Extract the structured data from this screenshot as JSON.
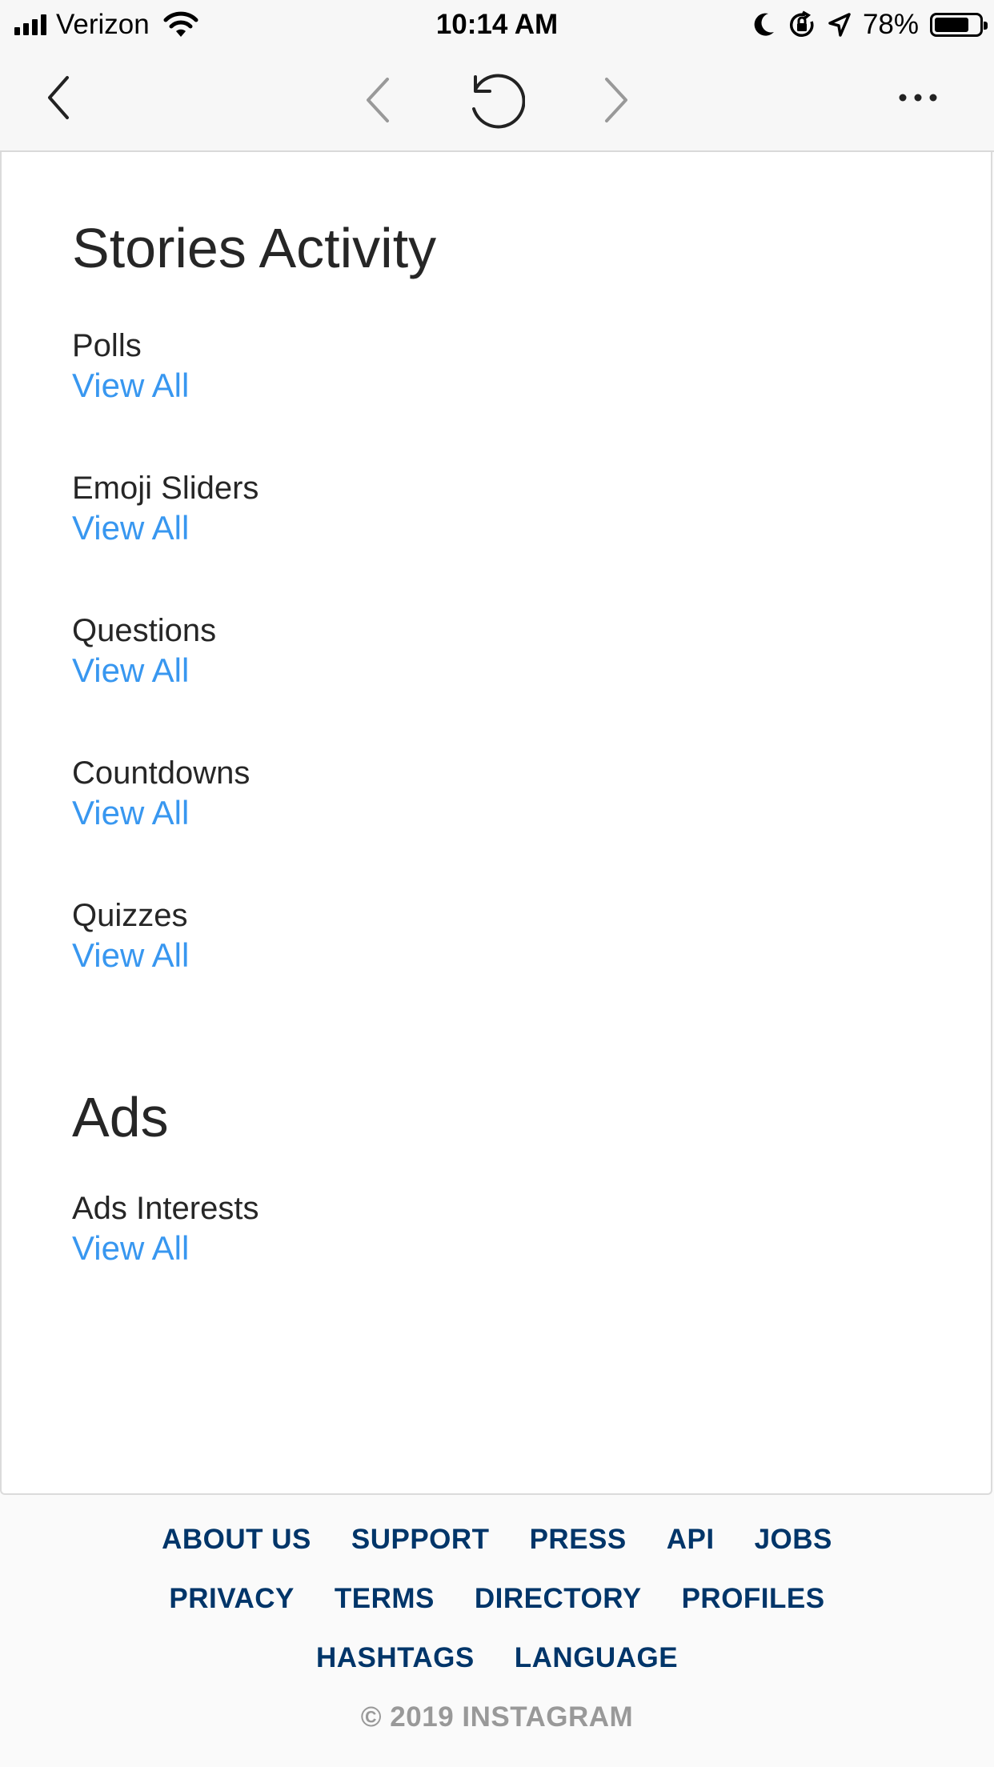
{
  "status_bar": {
    "carrier": "Verizon",
    "time": "10:14 AM",
    "battery_percent": "78%",
    "battery_level": 0.78,
    "icons": [
      "signal-icon",
      "wifi-icon",
      "moon-icon",
      "orientation-lock-icon",
      "location-icon",
      "battery-icon"
    ]
  },
  "toolbar": {
    "icons": [
      "back-icon",
      "browser-back-icon",
      "reload-icon",
      "browser-forward-icon",
      "more-icon"
    ]
  },
  "stories": {
    "title": "Stories Activity",
    "items": [
      {
        "label": "Polls",
        "link": "View All"
      },
      {
        "label": "Emoji Sliders",
        "link": "View All"
      },
      {
        "label": "Questions",
        "link": "View All"
      },
      {
        "label": "Countdowns",
        "link": "View All"
      },
      {
        "label": "Quizzes",
        "link": "View All"
      }
    ]
  },
  "ads": {
    "title": "Ads",
    "items": [
      {
        "label": "Ads Interests",
        "link": "View All"
      }
    ]
  },
  "footer": {
    "rows": [
      [
        "ABOUT US",
        "SUPPORT",
        "PRESS",
        "API",
        "JOBS"
      ],
      [
        "PRIVACY",
        "TERMS",
        "DIRECTORY",
        "PROFILES"
      ],
      [
        "HASHTAGS",
        "LANGUAGE"
      ]
    ],
    "copyright": "© 2019 INSTAGRAM"
  },
  "colors": {
    "link": "#3897f0",
    "footer_link": "#003569",
    "copyright": "#999999",
    "text": "#262626"
  }
}
